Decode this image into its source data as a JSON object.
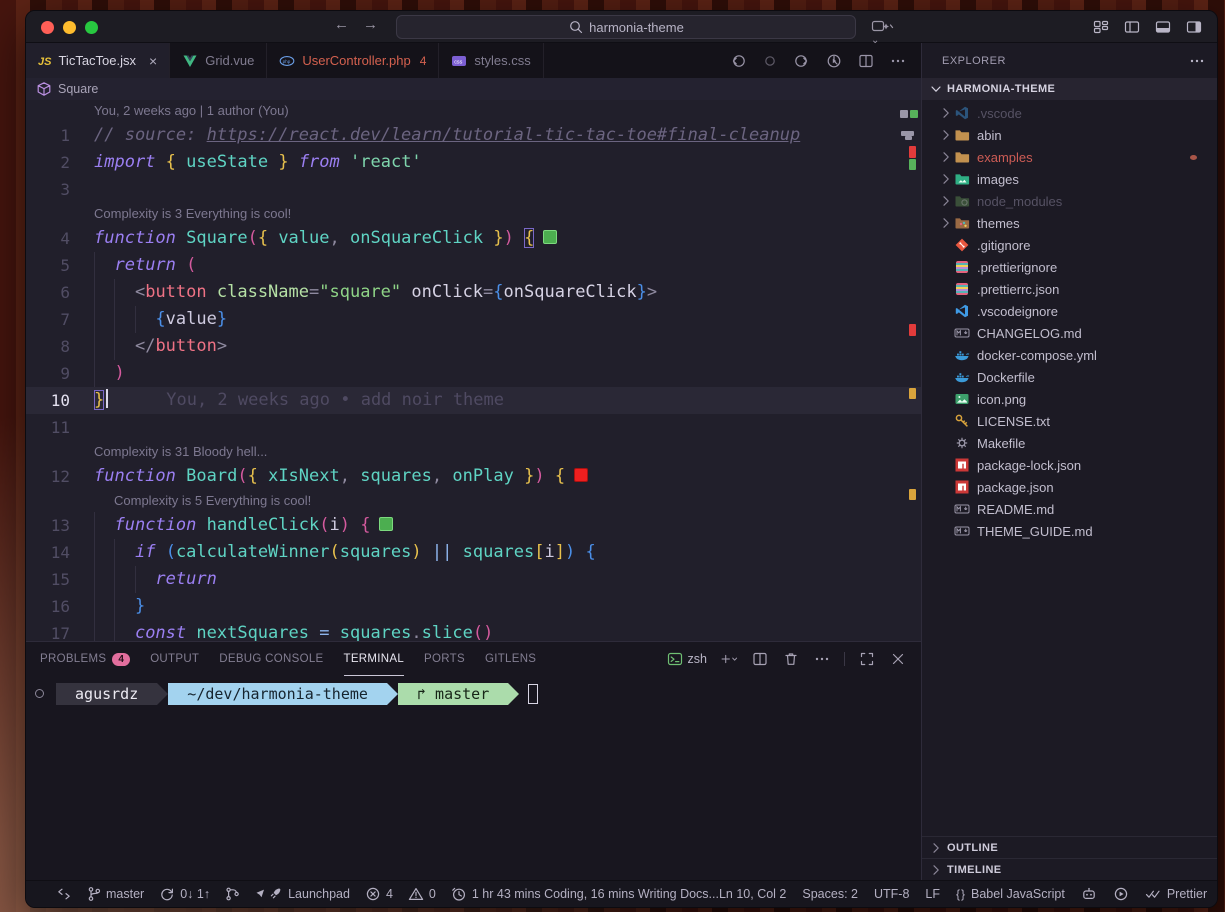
{
  "titlebar": {
    "search_value": "harmonia-theme",
    "window_controls": [
      "close",
      "minimize",
      "zoom"
    ],
    "right_icons": [
      "customize-layout",
      "toggle-primary-sidebar",
      "toggle-panel",
      "toggle-secondary-sidebar"
    ]
  },
  "tabs": [
    {
      "label": "TicTacToe.jsx",
      "icon": "js",
      "active": true,
      "close": true
    },
    {
      "label": "Grid.vue",
      "icon": "vue"
    },
    {
      "label": "UserController.php",
      "icon": "php",
      "error_count": "4"
    },
    {
      "label": "styles.css",
      "icon": "css"
    }
  ],
  "editor_actions": [
    "nav-back",
    "nav-dot",
    "nav-forward",
    "run-circle",
    "split-editor",
    "more"
  ],
  "breadcrumb": {
    "symbol": "Square"
  },
  "editor": {
    "rows": [
      {
        "k": "lens",
        "ind": 0,
        "t": "You, 2 weeks ago | 1 author (You)"
      },
      {
        "k": "code",
        "n": "1",
        "tk": [
          [
            "cmt",
            "// source: "
          ],
          [
            "cmt lnk",
            "https://react.dev/learn/tutorial-tic-tac-toe#final-cleanup"
          ]
        ]
      },
      {
        "k": "code",
        "n": "2",
        "tk": [
          [
            "kw",
            "import"
          ],
          [
            "pl",
            " "
          ],
          [
            "by",
            "{"
          ],
          [
            "pl",
            " "
          ],
          [
            "id",
            "useState"
          ],
          [
            "pl",
            " "
          ],
          [
            "by",
            "}"
          ],
          [
            "pl",
            " "
          ],
          [
            "kw",
            "from"
          ],
          [
            "pl",
            " "
          ],
          [
            "st",
            "'react'"
          ]
        ]
      },
      {
        "k": "code",
        "n": "3",
        "tk": []
      },
      {
        "k": "lens",
        "ind": 0,
        "t": "Complexity is 3 Everything is cool!"
      },
      {
        "k": "code",
        "n": "4",
        "tk": [
          [
            "kw",
            "function"
          ],
          [
            "pl",
            " "
          ],
          [
            "id",
            "Square"
          ],
          [
            "bp",
            "("
          ],
          [
            "by",
            "{"
          ],
          [
            "pl",
            " "
          ],
          [
            "id",
            "value"
          ],
          [
            "pu",
            ","
          ],
          [
            "pl",
            " "
          ],
          [
            "id",
            "onSquareClick"
          ],
          [
            "pl",
            " "
          ],
          [
            "by",
            "}"
          ],
          [
            "bp",
            ")"
          ],
          [
            "pl",
            " "
          ],
          [
            "by m",
            "{"
          ]
        ],
        "deco": "g"
      },
      {
        "k": "code",
        "n": "5",
        "tk": [
          [
            "pl",
            "  "
          ],
          [
            "kw",
            "return"
          ],
          [
            "pl",
            " "
          ],
          [
            "bp",
            "("
          ]
        ]
      },
      {
        "k": "code",
        "n": "6",
        "tk": [
          [
            "pl",
            "    "
          ],
          [
            "pu",
            "<"
          ],
          [
            "tag",
            "button"
          ],
          [
            "pl",
            " "
          ],
          [
            "at",
            "className"
          ],
          [
            "pu",
            "="
          ],
          [
            "st2",
            "\"square\""
          ],
          [
            "pl",
            " "
          ],
          [
            "at2",
            "onClick"
          ],
          [
            "pu",
            "="
          ],
          [
            "bb",
            "{"
          ],
          [
            "pl2",
            "onSquareClick"
          ],
          [
            "bb",
            "}"
          ],
          [
            "pu",
            ">"
          ]
        ]
      },
      {
        "k": "code",
        "n": "7",
        "tk": [
          [
            "pl",
            "      "
          ],
          [
            "bb",
            "{"
          ],
          [
            "pl",
            "value"
          ],
          [
            "bb",
            "}"
          ]
        ]
      },
      {
        "k": "code",
        "n": "8",
        "tk": [
          [
            "pl",
            "    "
          ],
          [
            "pu",
            "</"
          ],
          [
            "tag",
            "button"
          ],
          [
            "pu",
            ">"
          ]
        ]
      },
      {
        "k": "code",
        "n": "9",
        "tk": [
          [
            "pl",
            "  "
          ],
          [
            "bp",
            ")"
          ]
        ]
      },
      {
        "k": "code",
        "n": "10",
        "cur": true,
        "caret": true,
        "tk": [
          [
            "by m",
            "}"
          ]
        ],
        "blame": "You, 2 weeks ago • add noir theme"
      },
      {
        "k": "code",
        "n": "11",
        "tk": []
      },
      {
        "k": "lens",
        "ind": 0,
        "t": "Complexity is 31 Bloody hell..."
      },
      {
        "k": "code",
        "n": "12",
        "tk": [
          [
            "kw",
            "function"
          ],
          [
            "pl",
            " "
          ],
          [
            "id",
            "Board"
          ],
          [
            "bp",
            "("
          ],
          [
            "by",
            "{"
          ],
          [
            "pl",
            " "
          ],
          [
            "id",
            "xIsNext"
          ],
          [
            "pu",
            ","
          ],
          [
            "pl",
            " "
          ],
          [
            "id",
            "squares"
          ],
          [
            "pu",
            ","
          ],
          [
            "pl",
            " "
          ],
          [
            "id",
            "onPlay"
          ],
          [
            "pl",
            " "
          ],
          [
            "by",
            "}"
          ],
          [
            "bp",
            ")"
          ],
          [
            "pl",
            " "
          ],
          [
            "by",
            "{"
          ]
        ],
        "deco": "r"
      },
      {
        "k": "lens",
        "ind": 20,
        "t": "Complexity is 5 Everything is cool!"
      },
      {
        "k": "code",
        "n": "13",
        "tk": [
          [
            "pl",
            "  "
          ],
          [
            "kw",
            "function"
          ],
          [
            "pl",
            " "
          ],
          [
            "id",
            "handleClick"
          ],
          [
            "bp",
            "("
          ],
          [
            "pl",
            "i"
          ],
          [
            "bp",
            ")"
          ],
          [
            "pl",
            " "
          ],
          [
            "bp",
            "{"
          ]
        ],
        "deco": "g"
      },
      {
        "k": "code",
        "n": "14",
        "tk": [
          [
            "pl",
            "    "
          ],
          [
            "kw",
            "if"
          ],
          [
            "pl",
            " "
          ],
          [
            "bb",
            "("
          ],
          [
            "id",
            "calculateWinner"
          ],
          [
            "by",
            "("
          ],
          [
            "id",
            "squares"
          ],
          [
            "by",
            ")"
          ],
          [
            "pl",
            " "
          ],
          [
            "op",
            "||"
          ],
          [
            "pl",
            " "
          ],
          [
            "id",
            "squares"
          ],
          [
            "by",
            "["
          ],
          [
            "pl",
            "i"
          ],
          [
            "by",
            "]"
          ],
          [
            "bb",
            ")"
          ],
          [
            "pl",
            " "
          ],
          [
            "bb",
            "{"
          ]
        ]
      },
      {
        "k": "code",
        "n": "15",
        "tk": [
          [
            "pl",
            "      "
          ],
          [
            "kw",
            "return"
          ]
        ]
      },
      {
        "k": "code",
        "n": "16",
        "tk": [
          [
            "pl",
            "    "
          ],
          [
            "bb",
            "}"
          ]
        ]
      },
      {
        "k": "code",
        "n": "17",
        "tk": [
          [
            "pl",
            "    "
          ],
          [
            "kw",
            "const"
          ],
          [
            "pl",
            " "
          ],
          [
            "id",
            "nextSquares"
          ],
          [
            "pl",
            " "
          ],
          [
            "op",
            "="
          ],
          [
            "pl",
            " "
          ],
          [
            "id",
            "squares"
          ],
          [
            "pu",
            "."
          ],
          [
            "id",
            "slice"
          ],
          [
            "bp",
            "()"
          ]
        ]
      }
    ],
    "ruler_marks": [
      {
        "t": 10,
        "r": 13,
        "w": 8,
        "h": 8,
        "c": "#9a96a8"
      },
      {
        "t": 10,
        "r": 3,
        "w": 8,
        "h": 8,
        "c": "#57b25b"
      },
      {
        "t": 31,
        "r": 7,
        "w": 13,
        "h": 5,
        "c": "#9a96a8"
      },
      {
        "t": 36,
        "r": 9,
        "w": 7,
        "h": 4,
        "c": "#9a96a8"
      },
      {
        "t": 46,
        "r": 5,
        "w": 7,
        "h": 12,
        "c": "#e23b3b"
      },
      {
        "t": 59,
        "r": 5,
        "w": 7,
        "h": 11,
        "c": "#57b25b"
      },
      {
        "t": 224,
        "r": 5,
        "w": 7,
        "h": 12,
        "c": "#e23b3b"
      },
      {
        "t": 288,
        "r": 5,
        "w": 7,
        "h": 11,
        "c": "#d9a43c"
      },
      {
        "t": 389,
        "r": 5,
        "w": 7,
        "h": 11,
        "c": "#d9a43c"
      }
    ]
  },
  "explorer": {
    "title": "EXPLORER",
    "root": "HARMONIA-THEME",
    "items": [
      {
        "name": ".vscode",
        "folder": true,
        "icon": "vscode",
        "dim": true
      },
      {
        "name": "abin",
        "folder": true,
        "icon": "folder"
      },
      {
        "name": "examples",
        "folder": true,
        "icon": "folder",
        "error": true,
        "dot": true
      },
      {
        "name": "images",
        "folder": true,
        "icon": "imgfolder"
      },
      {
        "name": "node_modules",
        "folder": true,
        "icon": "nodefolder",
        "dim": true
      },
      {
        "name": "themes",
        "folder": true,
        "icon": "themefolder"
      },
      {
        "name": ".gitignore",
        "icon": "git"
      },
      {
        "name": ".prettierignore",
        "icon": "prettier"
      },
      {
        "name": ".prettierrc.json",
        "icon": "prettier"
      },
      {
        "name": ".vscodeignore",
        "icon": "vscode"
      },
      {
        "name": "CHANGELOG.md",
        "icon": "md"
      },
      {
        "name": "docker-compose.yml",
        "icon": "docker"
      },
      {
        "name": "Dockerfile",
        "icon": "docker"
      },
      {
        "name": "icon.png",
        "icon": "image"
      },
      {
        "name": "LICENSE.txt",
        "icon": "key"
      },
      {
        "name": "Makefile",
        "icon": "make"
      },
      {
        "name": "package-lock.json",
        "icon": "npm"
      },
      {
        "name": "package.json",
        "icon": "npm"
      },
      {
        "name": "README.md",
        "icon": "md"
      },
      {
        "name": "THEME_GUIDE.md",
        "icon": "md"
      }
    ],
    "sections": [
      "OUTLINE",
      "TIMELINE"
    ]
  },
  "panel": {
    "tabs": [
      {
        "label": "PROBLEMS",
        "badge": "4"
      },
      {
        "label": "OUTPUT"
      },
      {
        "label": "DEBUG CONSOLE"
      },
      {
        "label": "TERMINAL",
        "active": true
      },
      {
        "label": "PORTS"
      },
      {
        "label": "GITLENS"
      }
    ],
    "shell_label": "zsh",
    "actions": [
      "plus",
      "chev-sm",
      "split-editor",
      "trash",
      "more",
      "divider",
      "maximize",
      "close"
    ]
  },
  "terminal": {
    "user": "agusrdz",
    "path": "~/dev/harmonia-theme",
    "branch_symbol": "↱",
    "branch": "master"
  },
  "statusbar": {
    "left": [
      {
        "icon": "remote",
        "label": "",
        "name": "remote-indicator"
      },
      {
        "icon": "branch",
        "label": "master",
        "name": "git-branch"
      },
      {
        "icon": "sync",
        "label": "0↓ 1↑",
        "name": "git-sync"
      },
      {
        "icon": "graph",
        "label": "",
        "name": "git-graph"
      },
      {
        "icon": "rocket2",
        "label": "Launchpad",
        "name": "launchpad"
      },
      {
        "icon": "error",
        "label": "4",
        "name": "problems-errors"
      },
      {
        "icon": "warning",
        "label": "0",
        "name": "problems-warnings"
      },
      {
        "icon": "clock",
        "label": "1 hr 43 mins Coding, 16 mins Writing Docs...",
        "name": "time-tracker"
      }
    ],
    "right": [
      {
        "label": "Ln 10, Col 2",
        "name": "cursor-position"
      },
      {
        "label": "Spaces: 2",
        "name": "indentation"
      },
      {
        "label": "UTF-8",
        "name": "encoding"
      },
      {
        "label": "LF",
        "name": "eol"
      },
      {
        "icon": "braces",
        "label": "Babel JavaScript",
        "name": "language-mode"
      },
      {
        "icon": "robot",
        "label": "",
        "name": "copilot"
      },
      {
        "icon": "play",
        "label": "",
        "name": "run-task"
      },
      {
        "icon": "checks",
        "label": "Prettier",
        "name": "formatter"
      },
      {
        "icon": "bell",
        "label": "",
        "name": "notifications"
      }
    ]
  }
}
